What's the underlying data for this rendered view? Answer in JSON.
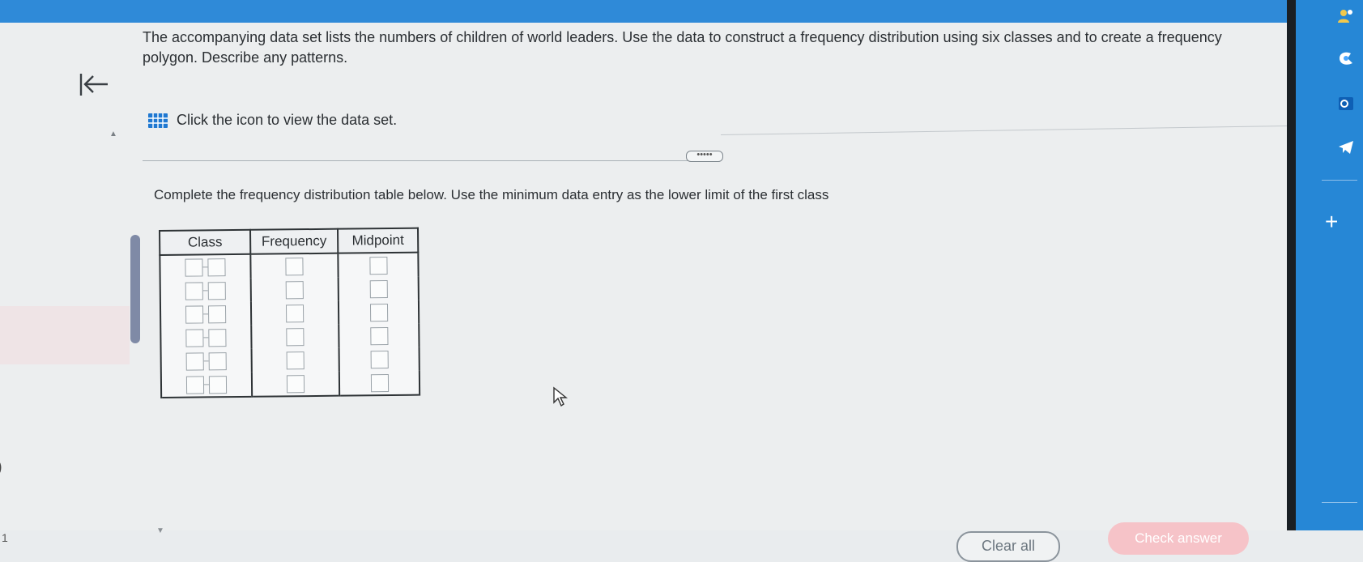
{
  "question": {
    "line1": "The accompanying data set lists the numbers of children of world leaders. Use the data to construct a frequency distribution using six classes and to create a frequency",
    "line2": "polygon. Describe any patterns."
  },
  "dataset_link": {
    "label": "Click the icon to view the data set."
  },
  "expand_label": "•••••",
  "instruction": "Complete the frequency distribution table below. Use the minimum data entry as the lower limit of the first class",
  "table": {
    "headers": {
      "class": "Class",
      "frequency": "Frequency",
      "midpoint": "Midpoint"
    },
    "rows": [
      {
        "class_lower": "",
        "class_upper": "",
        "frequency": "",
        "midpoint": ""
      },
      {
        "class_lower": "",
        "class_upper": "",
        "frequency": "",
        "midpoint": ""
      },
      {
        "class_lower": "",
        "class_upper": "",
        "frequency": "",
        "midpoint": ""
      },
      {
        "class_lower": "",
        "class_upper": "",
        "frequency": "",
        "midpoint": ""
      },
      {
        "class_lower": "",
        "class_upper": "",
        "frequency": "",
        "midpoint": ""
      },
      {
        "class_lower": "",
        "class_upper": "",
        "frequency": "",
        "midpoint": ""
      }
    ]
  },
  "buttons": {
    "clear_all": "Clear all",
    "check_answer": "Check answer"
  },
  "margin_label": "1",
  "sidebar": {
    "icons": [
      "people-icon",
      "copilot-icon",
      "outlook-icon",
      "telegram-icon"
    ],
    "plus": "+"
  },
  "colors": {
    "accent": "#2f8ad8",
    "check_answer_bg": "#f6c3c8",
    "scrollbar": "#7f8aa6",
    "sidebar": "#2687d6"
  }
}
